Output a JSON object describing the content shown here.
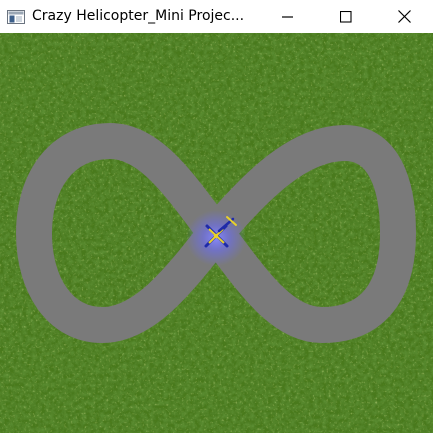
{
  "window": {
    "title": "Crazy Helicopter_Mini Projec...",
    "app_icon": "window-app-icon",
    "controls": {
      "minimize_icon": "minimize-icon",
      "maximize_icon": "maximize-icon",
      "close_icon": "close-icon"
    }
  },
  "game": {
    "background": "grass",
    "track_shape": "figure-eight",
    "track_color": "#787878",
    "grass_color": "#4a7a1e",
    "helicopter": {
      "icon": "helicopter-icon",
      "body_color": "#1f2aa8",
      "rotor_color": "#e8d12a",
      "glow_color": "#6a6cff"
    }
  }
}
